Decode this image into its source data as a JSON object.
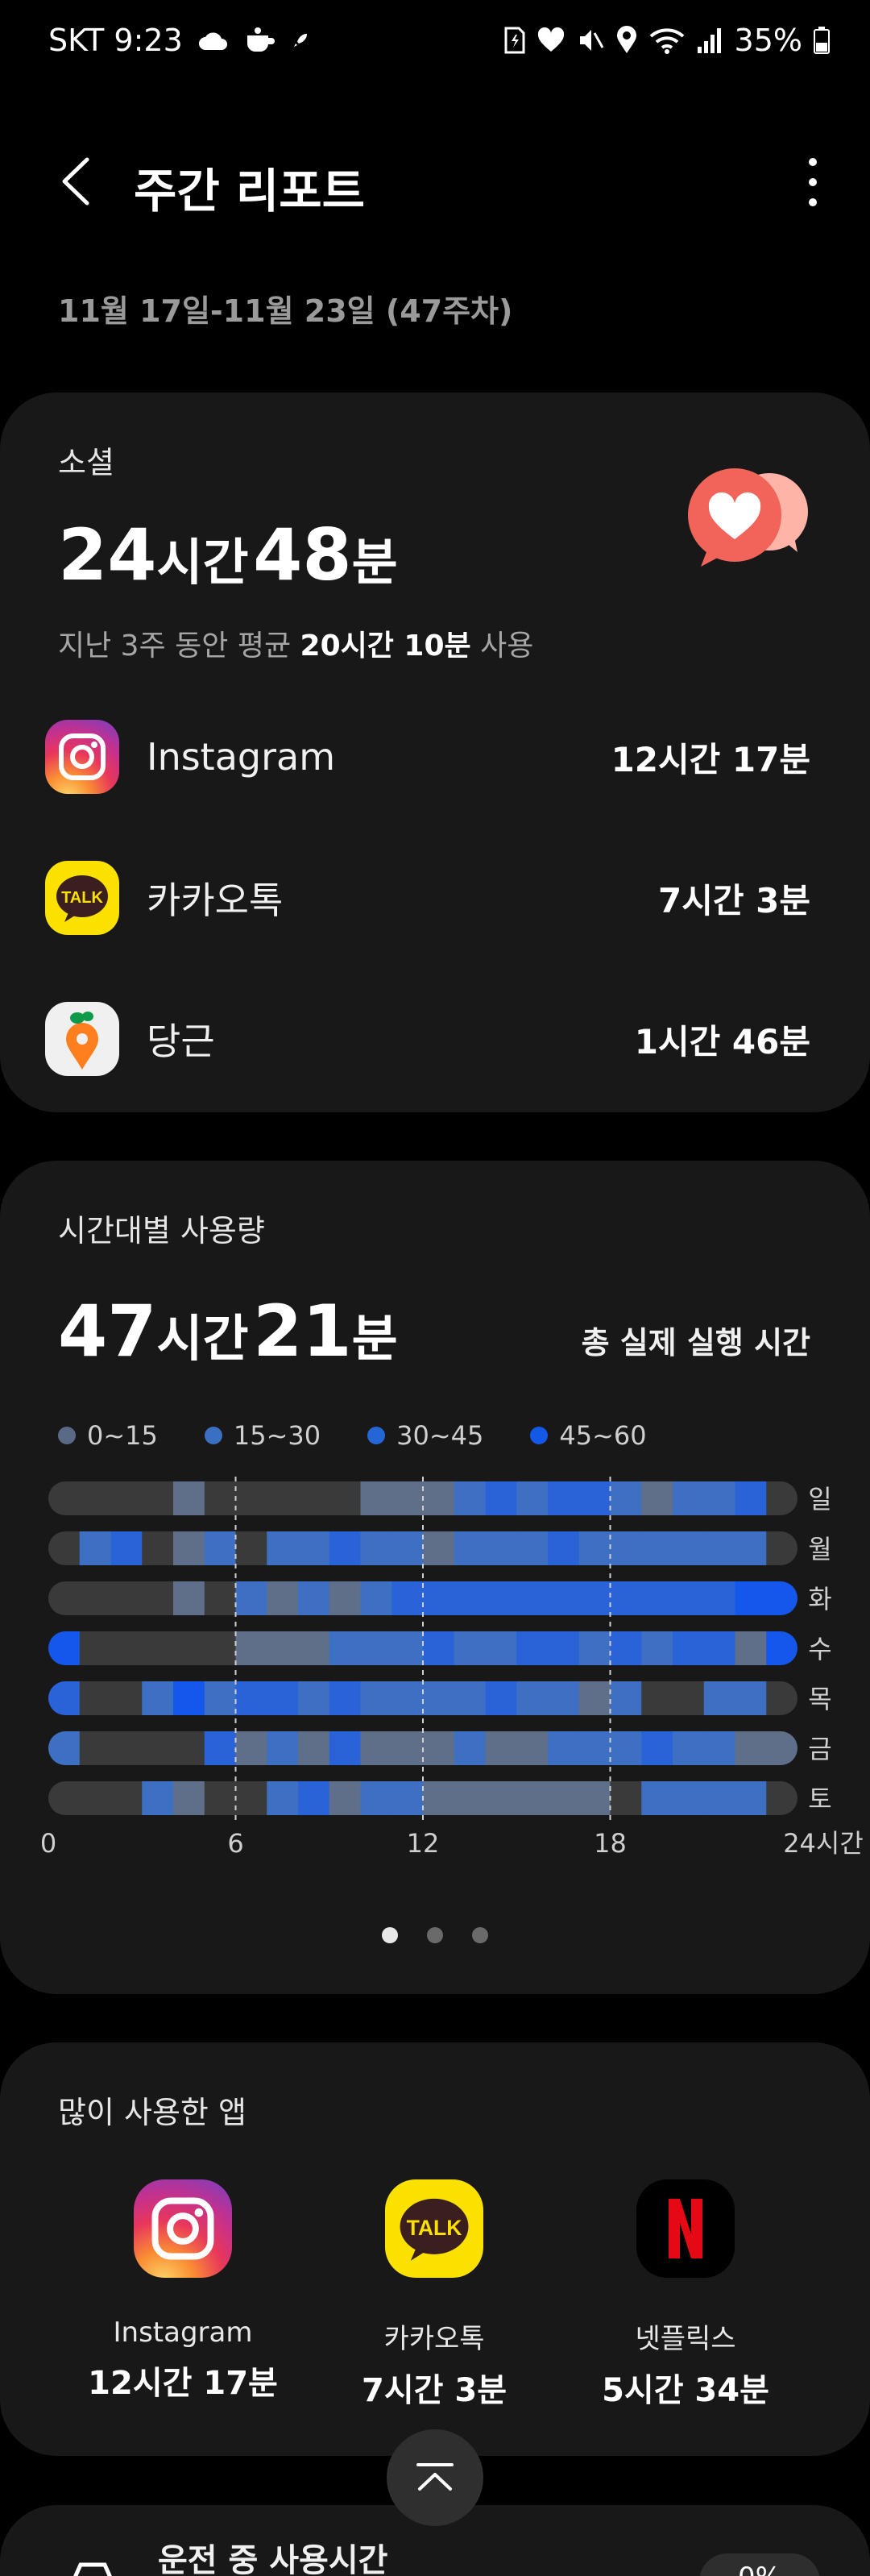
{
  "status_bar": {
    "carrier": "SKT",
    "time": "9:23",
    "battery": "35%"
  },
  "header": {
    "title": "주간 리포트"
  },
  "date_range": "11월 17일-11월 23일 (47주차)",
  "social": {
    "category": "소셜",
    "total_hours": "24",
    "hours_unit": "시간",
    "total_minutes": "48",
    "minutes_unit": "분",
    "avg_prefix": "지난 3주 동안 평균",
    "avg_value": "20시간 10분",
    "avg_suffix": "사용",
    "apps": [
      {
        "name": "Instagram",
        "time": "12시간 17분",
        "icon": "instagram-icon"
      },
      {
        "name": "카카오톡",
        "time": "7시간 3분",
        "icon": "kakaotalk-icon"
      },
      {
        "name": "당근",
        "time": "1시간 46분",
        "icon": "daangn-icon"
      }
    ]
  },
  "timeline": {
    "title": "시간대별 사용량",
    "total_hours": "47",
    "hours_unit": "시간",
    "total_minutes": "21",
    "minutes_unit": "분",
    "total_label": "총 실제 실행 시간",
    "legend": [
      {
        "label": "0~15",
        "color": "#5a6a86"
      },
      {
        "label": "15~30",
        "color": "#3b6fc0"
      },
      {
        "label": "30~45",
        "color": "#2566d6"
      },
      {
        "label": "45~60",
        "color": "#1458e8"
      }
    ],
    "colors": {
      "none": "#3a3a3a",
      "level1": "#5f6f8a",
      "level2": "#3d6fc2",
      "level3": "#2a63d8",
      "level4": "#1557ea"
    },
    "day_labels": [
      "일",
      "월",
      "화",
      "수",
      "목",
      "금",
      "토"
    ],
    "x_ticks": [
      "0",
      "6",
      "12",
      "18",
      "24시간"
    ],
    "levels": [
      [
        0,
        0,
        0,
        0,
        1,
        0,
        0,
        0,
        0,
        0,
        1,
        1,
        1,
        2,
        3,
        2,
        3,
        3,
        2,
        1,
        2,
        2,
        3,
        0
      ],
      [
        0,
        2,
        3,
        0,
        1,
        2,
        0,
        2,
        2,
        3,
        2,
        2,
        1,
        2,
        2,
        2,
        3,
        2,
        2,
        2,
        2,
        2,
        2,
        0
      ],
      [
        0,
        0,
        0,
        0,
        1,
        0,
        2,
        1,
        2,
        1,
        2,
        3,
        3,
        3,
        3,
        3,
        3,
        3,
        3,
        3,
        3,
        3,
        4,
        4
      ],
      [
        4,
        0,
        0,
        0,
        0,
        0,
        1,
        1,
        1,
        2,
        2,
        2,
        3,
        2,
        2,
        3,
        3,
        2,
        3,
        2,
        3,
        3,
        1,
        4
      ],
      [
        3,
        0,
        0,
        2,
        4,
        2,
        3,
        3,
        2,
        3,
        2,
        2,
        2,
        2,
        3,
        2,
        2,
        1,
        2,
        0,
        0,
        2,
        2,
        0
      ],
      [
        2,
        0,
        0,
        0,
        0,
        3,
        1,
        2,
        1,
        3,
        1,
        1,
        1,
        2,
        1,
        1,
        2,
        2,
        2,
        3,
        2,
        2,
        1,
        1
      ],
      [
        0,
        0,
        0,
        2,
        1,
        0,
        0,
        2,
        3,
        1,
        2,
        2,
        1,
        1,
        1,
        1,
        1,
        1,
        0,
        2,
        2,
        2,
        2,
        0
      ]
    ]
  },
  "top_apps": {
    "title": "많이 사용한 앱",
    "apps": [
      {
        "name": "Instagram",
        "time": "12시간 17분",
        "icon": "instagram-icon"
      },
      {
        "name": "카카오톡",
        "time": "7시간 3분",
        "icon": "kakaotalk-icon"
      },
      {
        "name": "넷플릭스",
        "time": "5시간 34분",
        "icon": "netflix-icon"
      }
    ]
  },
  "driving": {
    "label": "운전 중 사용시간",
    "value": "0%"
  }
}
